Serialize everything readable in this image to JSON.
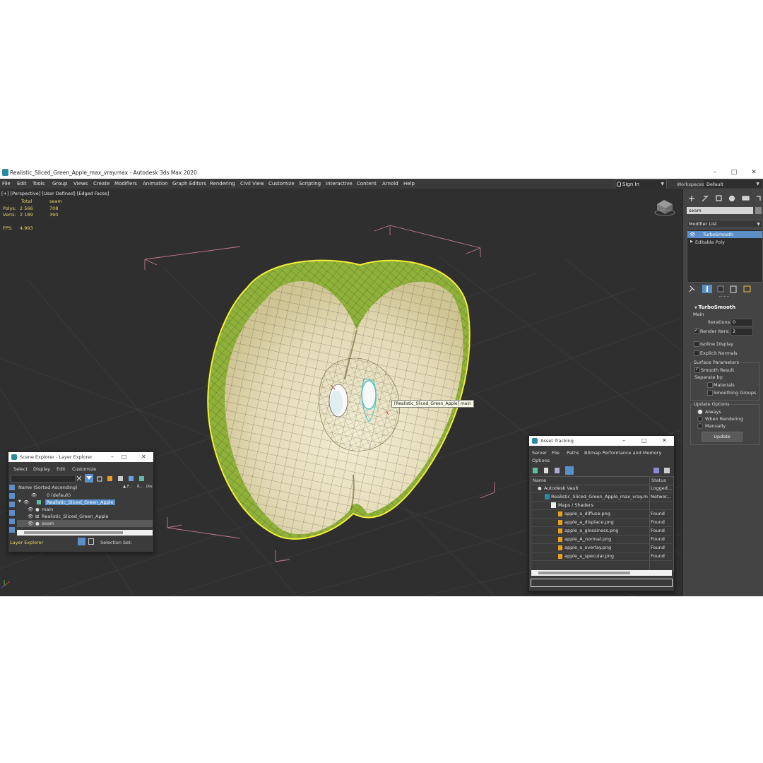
{
  "window": {
    "title": "Realistic_Sliced_Green_Apple_max_vray.max - Autodesk 3ds Max 2020"
  },
  "menu": [
    "File",
    "Edit",
    "Tools",
    "Group",
    "Views",
    "Create",
    "Modifiers",
    "Animation",
    "Graph Editors",
    "Rendering",
    "Civil View",
    "Customize",
    "Scripting",
    "Interactive",
    "Content",
    "Arnold",
    "Help"
  ],
  "header": {
    "sign_in": "Sign In",
    "workspaces_label": "Workspaces:",
    "workspace": "Default"
  },
  "viewport": {
    "label": "[+] [Perspective] [User Defined] [Edged Faces]",
    "stats": {
      "total_label": "Total",
      "seam_label": "seam",
      "polys_label": "Polys:",
      "polys_total": "2 566",
      "polys_seam": "708",
      "verts_label": "Verts:",
      "verts_total": "2 189",
      "verts_seam": "390",
      "fps_label": "FPS:",
      "fps_value": "4.993"
    },
    "tooltip": "[Realistic_Sliced_Green_Apple] main"
  },
  "command_panel": {
    "search_value": "seam",
    "modifier_list": "Modifier List",
    "stack": [
      "TurboSmooth",
      "Editable Poly"
    ],
    "rollout_title": "TurboSmooth",
    "main_label": "Main",
    "iterations_label": "Iterations:",
    "iterations_value": "0",
    "render_iters_label": "Render Iters:",
    "render_iters_value": "2",
    "isoline_label": "Isoline Display",
    "explicit_normals_label": "Explicit Normals",
    "surface_params_label": "Surface Parameters",
    "smooth_result_label": "Smooth Result",
    "separate_by_label": "Separate by:",
    "materials_label": "Materials",
    "smoothing_groups_label": "Smoothing Groups",
    "update_options_label": "Update Options",
    "always_label": "Always",
    "when_rendering_label": "When Rendering",
    "manually_label": "Manually",
    "update_button": "Update"
  },
  "scene_explorer": {
    "title": "Scene Explorer - Layer Explorer",
    "menu": [
      "Select",
      "Display",
      "Edit",
      "Customize"
    ],
    "col_name": "Name (Sorted Ascending)",
    "col_f": "▲ F...",
    "col_r": "R...",
    "col_d": "Dis",
    "rows": [
      "0 (default)",
      "Realistic_Sliced_Green_Apple",
      "main",
      "Realistic_Sliced_Green_Apple",
      "seam"
    ],
    "footer_label": "Layer Explorer",
    "selection_set_label": "Selection Set:"
  },
  "asset_tracking": {
    "title": "Asset Tracking",
    "menu": [
      "Server",
      "File",
      "Paths",
      "Bitmap Performance and Memory",
      "Options"
    ],
    "col_name": "Name",
    "col_status": "Status",
    "rows": [
      {
        "name": "Autodesk Vault",
        "status": "Logged..."
      },
      {
        "name": "Realistic_Sliced_Green_Apple_max_vray.max",
        "status": "Networ..."
      },
      {
        "name": "Maps / Shaders",
        "status": ""
      },
      {
        "name": "apple_a_diffuse.png",
        "status": "Found"
      },
      {
        "name": "apple_a_displace.png",
        "status": "Found"
      },
      {
        "name": "apple_a_glossiness.png",
        "status": "Found"
      },
      {
        "name": "apple_A_normal.png",
        "status": "Found"
      },
      {
        "name": "apple_a_overlay.png",
        "status": "Found"
      },
      {
        "name": "apple_a_specular.png",
        "status": "Found"
      }
    ]
  },
  "colors": {
    "app_bg": "#444444",
    "viewport_bg": "#2f2f2f",
    "selection_blue": "#5a8fc8",
    "stats_yellow": "#e8d66a",
    "apple_outline": "#f2ee3a",
    "apple_flesh": "#e6dfbf",
    "apple_skin": "#8fb13a"
  }
}
